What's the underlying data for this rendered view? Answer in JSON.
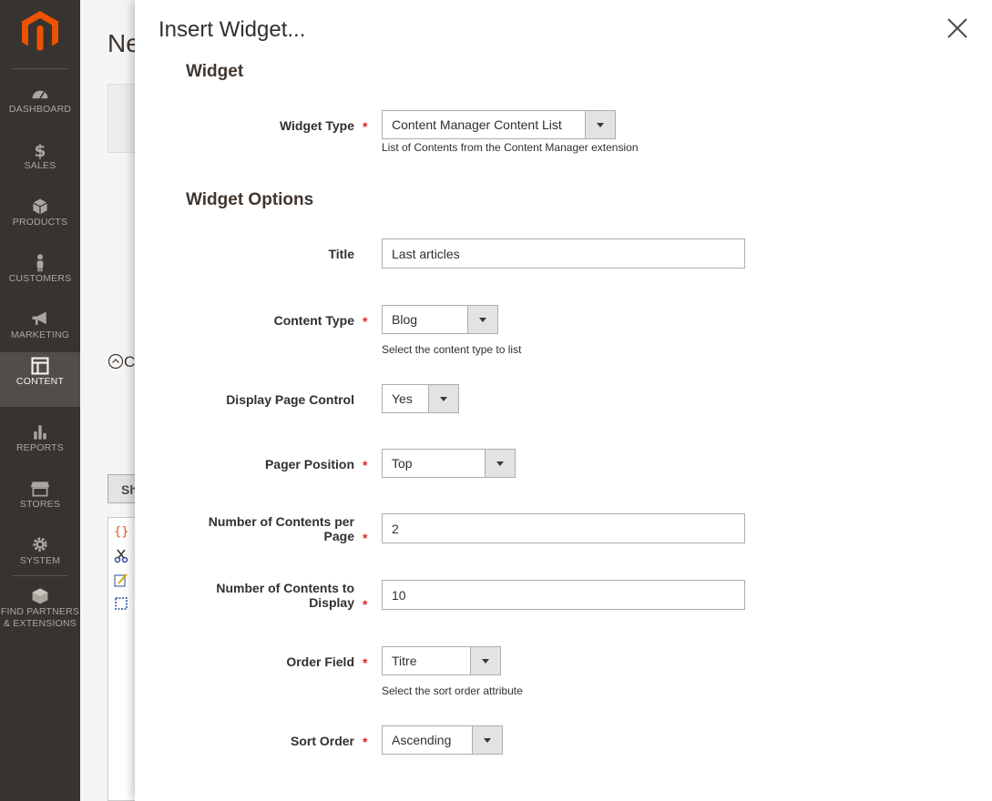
{
  "sidebar": {
    "items": [
      {
        "label": "DASHBOARD",
        "icon": "dashboard-icon"
      },
      {
        "label": "SALES",
        "icon": "dollar-icon"
      },
      {
        "label": "PRODUCTS",
        "icon": "box-icon"
      },
      {
        "label": "CUSTOMERS",
        "icon": "person-icon"
      },
      {
        "label": "MARKETING",
        "icon": "megaphone-icon"
      },
      {
        "label": "CONTENT",
        "icon": "layout-icon"
      },
      {
        "label": "REPORTS",
        "icon": "bar-chart-icon"
      },
      {
        "label": "STORES",
        "icon": "store-icon"
      },
      {
        "label": "SYSTEM",
        "icon": "gear-icon"
      },
      {
        "label_line1": "FIND PARTNERS",
        "label_line2": "& EXTENSIONS",
        "icon": "cube-icon"
      }
    ],
    "active": "CONTENT"
  },
  "background": {
    "title_fragment": "Ne",
    "collapse_fragment": "C",
    "button_fragment": "Sh"
  },
  "modal": {
    "title": "Insert Widget...",
    "section_widget": "Widget",
    "section_options": "Widget Options",
    "widget_type": {
      "label": "Widget Type",
      "value": "Content Manager Content List",
      "note": "List of Contents from the Content Manager extension"
    },
    "title_field": {
      "label": "Title",
      "value": "Last articles"
    },
    "content_type": {
      "label": "Content Type",
      "value": "Blog",
      "note": "Select the content type to list"
    },
    "display_page_control": {
      "label": "Display Page Control",
      "value": "Yes"
    },
    "pager_position": {
      "label": "Pager Position",
      "value": "Top"
    },
    "per_page": {
      "label_line1": "Number of Contents per",
      "label_line2": "Page",
      "value": "2"
    },
    "to_display": {
      "label_line1": "Number of Contents to",
      "label_line2": "Display",
      "value": "10"
    },
    "order_field": {
      "label": "Order Field",
      "value": "Titre",
      "note": "Select the sort order attribute"
    },
    "sort_order": {
      "label": "Sort Order",
      "value": "Ascending"
    },
    "required_mark": "*"
  },
  "colors": {
    "sidebar_bg": "#373330",
    "sidebar_active": "#524d49",
    "brand": "#eb5202",
    "required": "#e22626"
  }
}
